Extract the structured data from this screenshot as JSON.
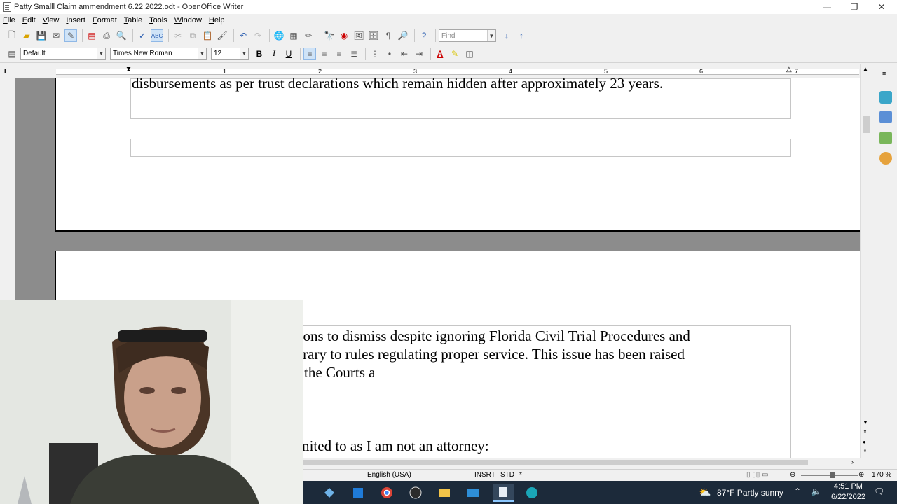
{
  "window": {
    "title": "Patty Smalll Claim ammendment 6.22.2022.odt - OpenOffice Writer",
    "minimize": "—",
    "maximize": "❐",
    "close": "✕"
  },
  "menu": [
    "File",
    "Edit",
    "View",
    "Insert",
    "Format",
    "Table",
    "Tools",
    "Window",
    "Help"
  ],
  "toolbar": {
    "find_placeholder": "Find",
    "paragraph_style": "Default",
    "font_name": "Times New Roman",
    "font_size": "12",
    "bold": "B",
    "italic": "I",
    "underline": "U"
  },
  "ruler": {
    "numbers": [
      "1",
      "2",
      "3",
      "4",
      "5",
      "6",
      "7"
    ]
  },
  "document": {
    "page1_line": "disbursements as per trust declarations which remain hidden after approximately 23 years.",
    "page2_lines": [
      "motions to dismiss despite ignoring Florida Civil Trial Procedures and",
      "contrary to rules regulating proper service. This issue has been  raised",
      "d by the Courts a"
    ],
    "page2_lower_line": "ot limited to as I am not an attorney:"
  },
  "statusbar": {
    "language": "English (USA)",
    "insert_mode": "INSRT",
    "selection_mode": "STD",
    "modified": "*",
    "zoom": "170 %"
  },
  "taskbar": {
    "weather": "87°F  Partly sunny",
    "time": "4:51 PM",
    "date": "6/22/2022"
  },
  "colors": {
    "taskbar": "#1c2a3a",
    "accent": "#0078d7",
    "page_background": "#8c8c8c"
  }
}
